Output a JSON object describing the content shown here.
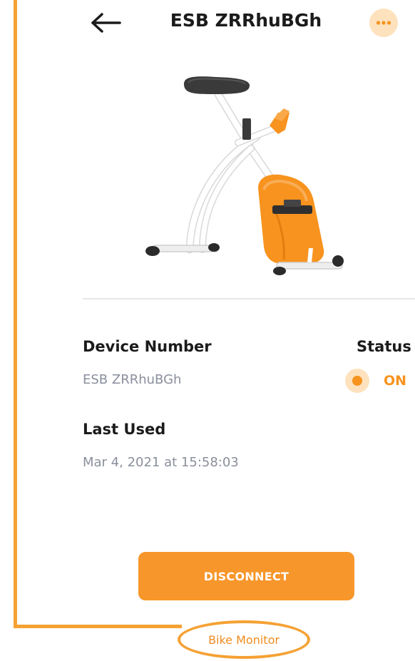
{
  "header": {
    "title": "ESB ZRRhuBGh"
  },
  "device": {
    "number_label": "Device Number",
    "number_value": "ESB ZRRhuBGh",
    "status_label": "Status",
    "status_value": "ON",
    "last_used_label": "Last Used",
    "last_used_value": "Mar 4, 2021 at 15:58:03"
  },
  "actions": {
    "disconnect_label": "DISCONNECT"
  },
  "annotation": {
    "callout_label": "Bike Monitor"
  },
  "icons": {
    "back": "arrow-left-icon",
    "more": "more-horizontal-icon",
    "status": "status-dot-icon"
  },
  "colors": {
    "accent": "#f7931e",
    "accent_light": "#fde2bd",
    "annotation": "#f5a134",
    "title_text": "#1b1b1b",
    "muted_text": "#8a8f9c"
  }
}
